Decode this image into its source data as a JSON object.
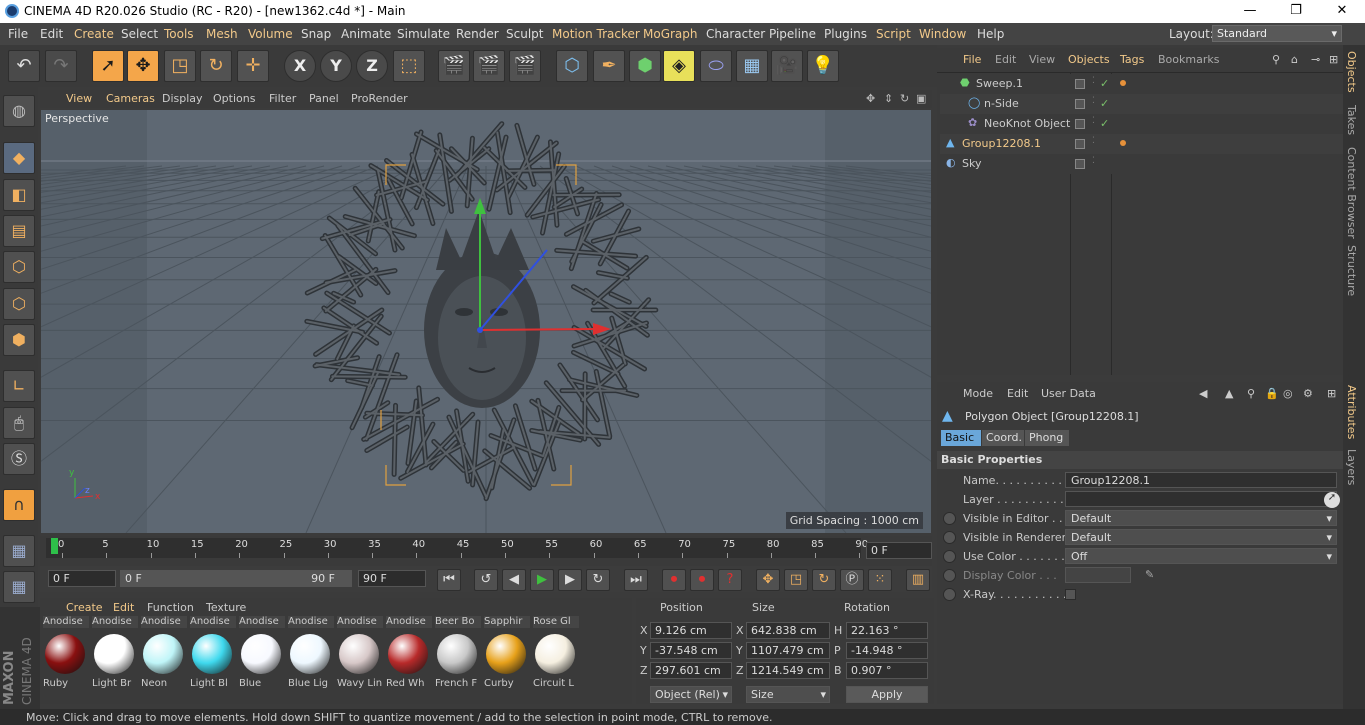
{
  "window": {
    "title": "CINEMA 4D R20.026 Studio (RC - R20) - [new1362.c4d *] - Main",
    "controls": [
      "—",
      "❐",
      "✕"
    ]
  },
  "menu": {
    "items": [
      "File",
      "Edit",
      "Create",
      "Select",
      "Tools",
      "Mesh",
      "Volume",
      "Snap",
      "Animate",
      "Simulate",
      "Render",
      "Sculpt",
      "Motion Tracker",
      "MoGraph",
      "Character",
      "Pipeline",
      "Plugins",
      "Script",
      "Window",
      "Help"
    ],
    "layout_label": "Layout:",
    "layout_value": "Standard"
  },
  "viewport": {
    "menu": [
      "View",
      "Cameras",
      "Display",
      "Options",
      "Filter",
      "Panel",
      "ProRender"
    ],
    "camera_label": "Perspective",
    "grid_spacing": "Grid Spacing : 1000 cm",
    "axis_labels": [
      "y",
      "z",
      "x"
    ]
  },
  "timeline": {
    "ticks": [
      "0",
      "5",
      "10",
      "15",
      "20",
      "25",
      "30",
      "35",
      "40",
      "45",
      "50",
      "55",
      "60",
      "65",
      "70",
      "75",
      "80",
      "85",
      "90"
    ],
    "current_frame": "0 F",
    "start": "0 F",
    "range_start": "0 F",
    "range_end": "90 F",
    "end": "90 F"
  },
  "materials": {
    "menu": [
      "Create",
      "Edit",
      "Function",
      "Texture"
    ],
    "items": [
      {
        "tab": "Anodise",
        "label": "Ruby",
        "color": "#8a1010"
      },
      {
        "tab": "Anodise",
        "label": "Light Br",
        "color": "#ffffff"
      },
      {
        "tab": "Anodise",
        "label": "Neon",
        "color": "#bff5f8"
      },
      {
        "tab": "Anodise",
        "label": "Light Bl",
        "color": "#3fd9ee"
      },
      {
        "tab": "Anodise",
        "label": "Blue",
        "color": "#f7f9ff"
      },
      {
        "tab": "Anodise",
        "label": "Blue Lig",
        "color": "#eef8ff"
      },
      {
        "tab": "Anodise",
        "label": "Wavy Lin",
        "color": "#d7c8c8"
      },
      {
        "tab": "Anodise",
        "label": "Red Wh",
        "color": "#b82a2a"
      },
      {
        "tab": "Beer Bo",
        "label": "French F",
        "color": "#c8c8c8"
      },
      {
        "tab": "Sapphir",
        "label": "Curby",
        "color": "#e7a11a"
      },
      {
        "tab": "Rose Gl",
        "label": "Circuit L",
        "color": "#f5efe0"
      }
    ]
  },
  "coordinates": {
    "headers": [
      "Position",
      "Size",
      "Rotation"
    ],
    "rows": [
      {
        "axis": "X",
        "pos": "9.126 cm",
        "saxis": "X",
        "size": "642.838 cm",
        "raxis": "H",
        "rot": "22.163 °"
      },
      {
        "axis": "Y",
        "pos": "-37.548 cm",
        "saxis": "Y",
        "size": "1107.479 cm",
        "raxis": "P",
        "rot": "-14.948 °"
      },
      {
        "axis": "Z",
        "pos": "297.601 cm",
        "saxis": "Z",
        "size": "1214.549 cm",
        "raxis": "B",
        "rot": "0.907 °"
      }
    ],
    "mode": "Object (Rel)",
    "size_mode": "Size",
    "apply": "Apply"
  },
  "objects_panel": {
    "tabs": [
      "File",
      "Edit",
      "View",
      "Objects",
      "Tags",
      "Bookmarks"
    ],
    "items": [
      {
        "name": "Sweep.1",
        "icon": "sweep-icon",
        "selected": false
      },
      {
        "name": "n-Side",
        "icon": "nside-icon",
        "selected": false
      },
      {
        "name": "NeoKnot Object",
        "icon": "neoknot-icon",
        "selected": false
      },
      {
        "name": "Group12208.1",
        "icon": "polygon-icon",
        "selected": true
      },
      {
        "name": "Sky",
        "icon": "sky-icon",
        "selected": false
      }
    ]
  },
  "attributes": {
    "tabs": [
      "Mode",
      "Edit",
      "User Data"
    ],
    "object_title": "Polygon Object [Group12208.1]",
    "subtabs": [
      "Basic",
      "Coord.",
      "Phong"
    ],
    "section": "Basic Properties",
    "props": [
      {
        "label": "Name. . . . . . . . . . . . .",
        "value": "Group12208.1"
      },
      {
        "label": "Layer . . . . . . . . . . . .",
        "value": ""
      },
      {
        "label": "Visible in Editor . . .",
        "value": "Default"
      },
      {
        "label": "Visible in Renderer",
        "value": "Default"
      },
      {
        "label": "Use Color . . . . . . .",
        "value": "Off"
      },
      {
        "label": "Display Color . . .",
        "value": ""
      },
      {
        "label": "X-Ray. . . . . . . . . . .",
        "value": ""
      }
    ]
  },
  "right_tabs": [
    "Objects",
    "Takes",
    "Content Browser",
    "Structure",
    "Attributes",
    "Layers"
  ],
  "branding": {
    "maxon": "MAXON",
    "product": "CINEMA 4D"
  },
  "status": "Move: Click and drag to move elements. Hold down SHIFT to quantize movement / add to the selection in point mode, CTRL to remove."
}
